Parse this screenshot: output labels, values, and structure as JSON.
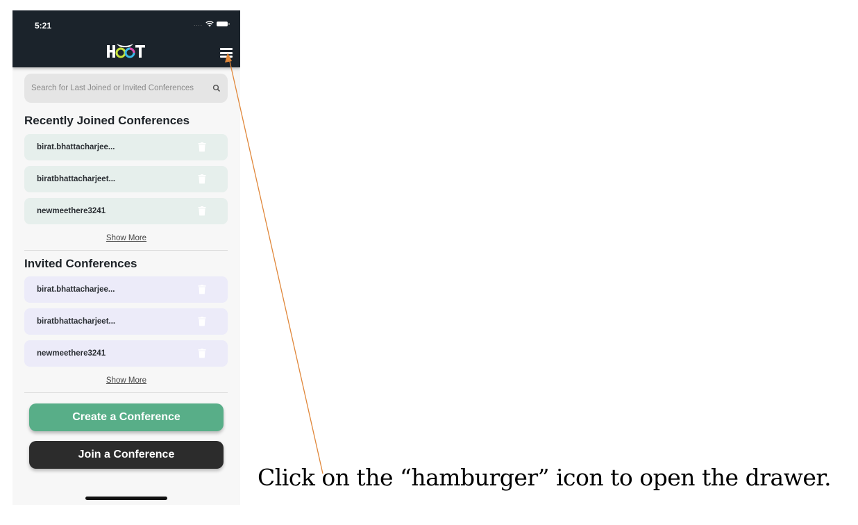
{
  "status_bar": {
    "time": "5:21",
    "signal": "....",
    "wifi_icon": "wifi-icon",
    "battery_icon": "battery-icon"
  },
  "header": {
    "logo_text": "HOOT",
    "menu_icon": "hamburger-icon"
  },
  "search": {
    "placeholder": "Search for Last Joined or Invited Conferences",
    "value": "",
    "icon": "search-icon"
  },
  "recent": {
    "title": "Recently Joined Conferences",
    "items": [
      {
        "name": "birat.bhattacharjee..."
      },
      {
        "name": "biratbhattacharjeet..."
      },
      {
        "name": "newmeethere3241"
      }
    ],
    "show_more": "Show More"
  },
  "invited": {
    "title": "Invited Conferences",
    "items": [
      {
        "name": "birat.bhattacharjee..."
      },
      {
        "name": "biratbhattacharjeet..."
      },
      {
        "name": "newmeethere3241"
      }
    ],
    "show_more": "Show More"
  },
  "actions": {
    "create_label": "Create a Conference",
    "join_label": "Join a Conference"
  },
  "colors": {
    "header_bg": "#1b232b",
    "recent_item_bg": "#e6efec",
    "invited_item_bg": "#ecebf9",
    "create_btn": "#58ae88",
    "join_btn": "#2c2c2c",
    "annotation_arrow": "#e0873a"
  },
  "annotation": {
    "caption": "Click on the “hamburger” icon to open the drawer."
  }
}
